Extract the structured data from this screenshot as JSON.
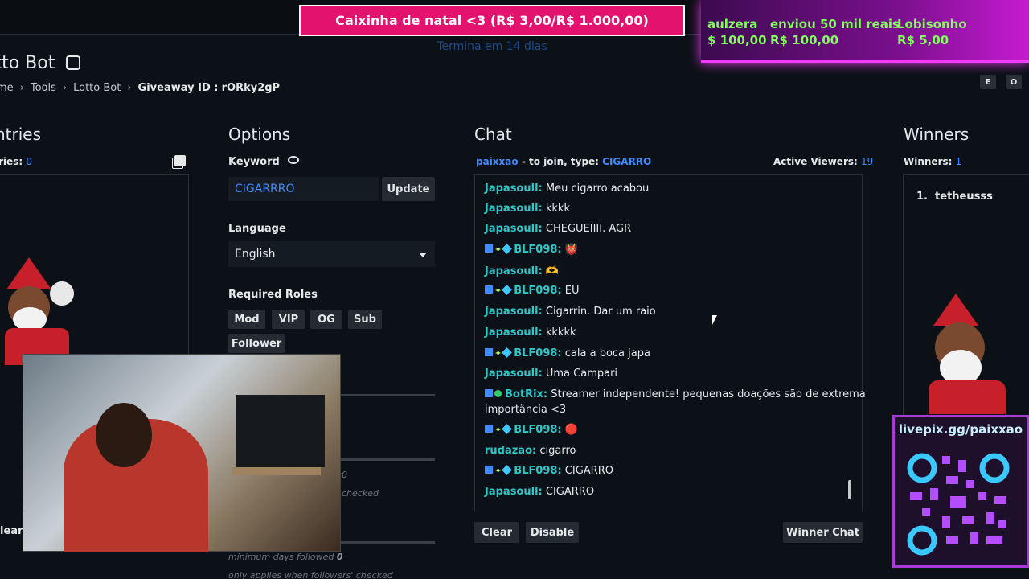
{
  "overlay": {
    "banner_text": "Caixinha de natal <3 (R$ 3,00/R$ 1.000,00)",
    "banner_sub": "Termina em 14 dias",
    "donations": [
      {
        "name": "aulzera",
        "amount": "$ 100,00"
      },
      {
        "name": "enviou 50 mil reais",
        "amount": "R$ 100,00"
      },
      {
        "name": "Lobisonho",
        "amount": "R$ 5,00"
      }
    ],
    "pix_url": "livepix.gg/paixxao"
  },
  "page": {
    "title": "otto Bot",
    "breadcrumb": [
      "me",
      "Tools",
      "Lotto Bot"
    ],
    "giveaway_label": "Giveaway ID :",
    "giveaway_id": "rORky2gP",
    "chips": [
      "E",
      "O"
    ]
  },
  "entries": {
    "title": "ntries",
    "count_label": "ries:",
    "count_value": "0",
    "clear_label": "lear"
  },
  "options": {
    "title": "Options",
    "keyword_label": "Keyword",
    "keyword_value": "CIGARRRO",
    "update_label": "Update",
    "language_label": "Language",
    "language_value": "English",
    "roles_label": "Required Roles",
    "roles": [
      "Mod",
      "VIP",
      "OG",
      "Sub",
      "Follower"
    ],
    "small_value": "0",
    "hidden_checked": "checked",
    "min_days_label": "minimum days followed",
    "min_days_value": "0",
    "followers_note": "only applies when followers' checked"
  },
  "chat": {
    "title": "Chat",
    "join_user": "paixxao",
    "join_text": "- to join, type:",
    "join_keyword": "CIGARRO",
    "viewers_label": "Active Viewers:",
    "viewers_value": "19",
    "messages": [
      {
        "user": "Japasoull:",
        "text": "Meu cigarro acabou",
        "badges": false
      },
      {
        "user": "Japasoull:",
        "text": "kkkk",
        "badges": false
      },
      {
        "user": "Japasoull:",
        "text": "CHEGUEIIII. AGR",
        "badges": false
      },
      {
        "user": "BLF098:",
        "text": "👹",
        "badges": true
      },
      {
        "user": "Japasoull:",
        "text": "🫶",
        "badges": false
      },
      {
        "user": "BLF098:",
        "text": "EU",
        "badges": true
      },
      {
        "user": "Japasoull:",
        "text": "Cigarrin. Dar um raio",
        "badges": false
      },
      {
        "user": "Japasoull:",
        "text": "kkkkk",
        "badges": false
      },
      {
        "user": "BLF098:",
        "text": "cala a boca japa",
        "badges": true
      },
      {
        "user": "Japasoull:",
        "text": "Uma Campari",
        "badges": false
      },
      {
        "user": "BotRix:",
        "text": "Streamer independente! pequenas doações são de extrema",
        "text2": "importância <3",
        "badges": true
      },
      {
        "user": "BLF098:",
        "text": "🔴",
        "badges": true
      },
      {
        "user": "rudazao:",
        "text": "cigarro",
        "badges": false
      },
      {
        "user": "BLF098:",
        "text": "CIGARRO",
        "badges": true
      },
      {
        "user": "Japasoull:",
        "text": "CIGARRO",
        "badges": false
      }
    ],
    "clear_label": "Clear",
    "disable_label": "Disable",
    "winner_chat_label": "Winner Chat"
  },
  "winners": {
    "title": "Winners",
    "count_label": "Winners:",
    "count_value": "1",
    "list": [
      "tetheusss"
    ]
  }
}
